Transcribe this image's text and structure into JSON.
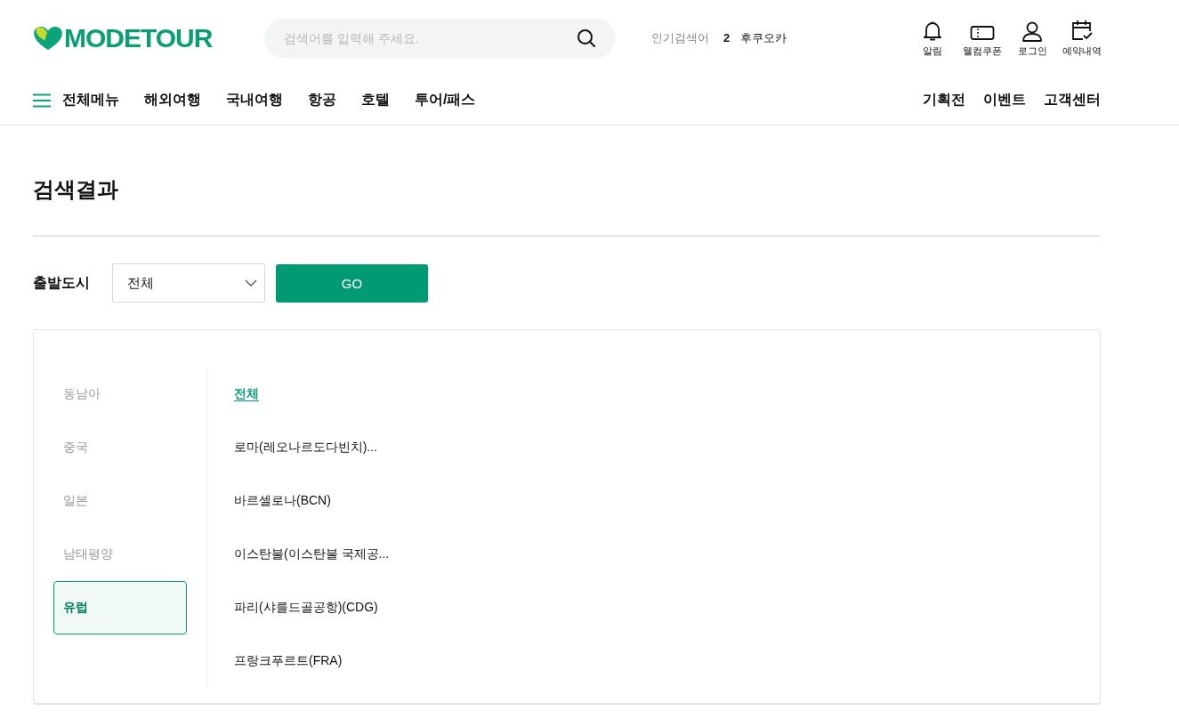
{
  "header": {
    "logo": "MODETOUR",
    "search": {
      "placeholder": "검색어를 입력해 주세요."
    },
    "popular": {
      "label": "인기검색어",
      "rank": "2",
      "keyword": "후쿠오카"
    },
    "shortcuts": [
      {
        "kind": "bell",
        "label": "알림"
      },
      {
        "kind": "coupon",
        "label": "웰컴쿠폰"
      },
      {
        "kind": "user",
        "label": "로그인"
      },
      {
        "kind": "calendar",
        "label": "예약내역"
      }
    ]
  },
  "nav": {
    "menu_label": "전체메뉴",
    "items": [
      "해외여행",
      "국내여행",
      "항공",
      "호텔",
      "투어/패스"
    ],
    "right_items": [
      "기획전",
      "이벤트",
      "고객센터"
    ]
  },
  "page_title": "검색결과",
  "filter": {
    "label": "출발도시",
    "select_value": "전체",
    "button": "GO"
  },
  "regions": [
    {
      "label": "동남아",
      "selected": false
    },
    {
      "label": "중국",
      "selected": false
    },
    {
      "label": "일본",
      "selected": false
    },
    {
      "label": "남태평양",
      "selected": false
    },
    {
      "label": "유럽",
      "selected": true
    }
  ],
  "cities": [
    {
      "label": "전체",
      "selected": true
    },
    {
      "label": "로마(레오나르도다빈치)...",
      "selected": false
    },
    {
      "label": "바르셀로나(BCN)",
      "selected": false
    },
    {
      "label": "이스탄불(이스탄불 국제공...",
      "selected": false
    },
    {
      "label": "파리(샤를드골공항)(CDG)",
      "selected": false
    },
    {
      "label": "프랑크푸르트(FRA)",
      "selected": false
    }
  ]
}
